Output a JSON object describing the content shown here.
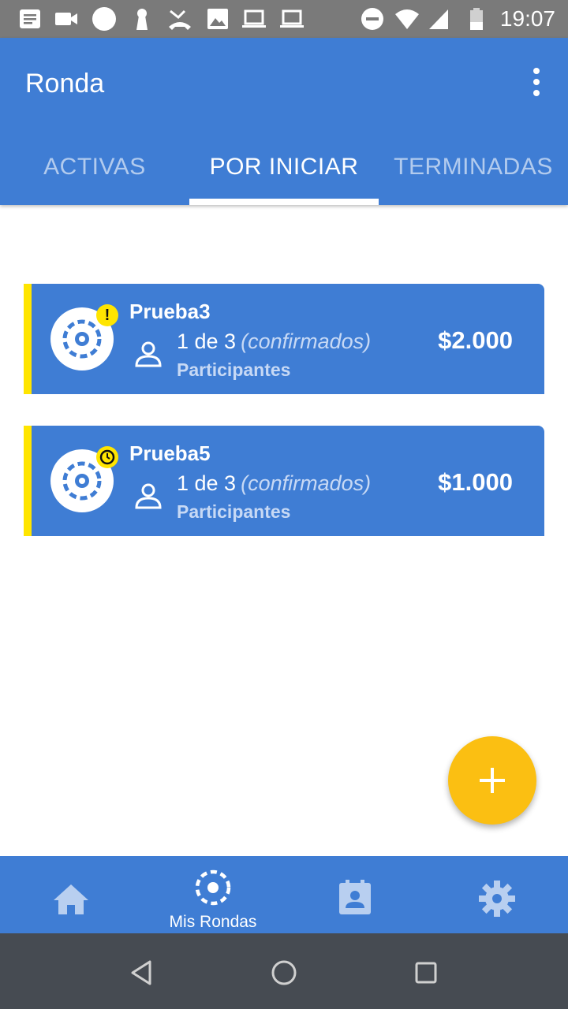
{
  "status_bar": {
    "time": "19:07",
    "left_icons": [
      "notes-icon",
      "video-icon",
      "circle-icon",
      "keyhole-icon",
      "missed-call-icon",
      "image-icon",
      "laptop-icon",
      "laptop-icon"
    ],
    "right_icons": [
      "do-not-disturb-icon",
      "wifi-icon",
      "signal-icon",
      "battery-icon"
    ]
  },
  "app_bar": {
    "title": "Ronda",
    "menu_icon": "more-vert-icon"
  },
  "tabs": [
    {
      "label": "ACTIVAS",
      "selected": false
    },
    {
      "label": "POR INICIAR",
      "selected": true
    },
    {
      "label": "TERMINADAS",
      "selected": false
    }
  ],
  "cards": [
    {
      "name": "Prueba3",
      "status_icon": "alert-icon",
      "status_glyph": "!",
      "participants_count": "1 de 3",
      "confirmed_note": "(confirmados)",
      "participants_label": "Participantes",
      "amount": "$2.000"
    },
    {
      "name": "Prueba5",
      "status_icon": "clock-icon",
      "status_glyph": "",
      "participants_count": "1 de 3",
      "confirmed_note": "(confirmados)",
      "participants_label": "Participantes",
      "amount": "$1.000"
    }
  ],
  "fab": {
    "icon": "plus-icon"
  },
  "bottom_nav": [
    {
      "icon": "home-icon",
      "label": ""
    },
    {
      "icon": "ronda-icon",
      "label": "Mis Rondas",
      "selected": true
    },
    {
      "icon": "contact-calendar-icon",
      "label": ""
    },
    {
      "icon": "settings-icon",
      "label": ""
    }
  ],
  "system_nav": [
    "back-icon",
    "home-circle-icon",
    "recents-icon"
  ],
  "colors": {
    "primary": "#3f7dd4",
    "accent": "#fbbf12",
    "card_stripe": "#ffe500",
    "status_bar": "#7a7a7a",
    "system_nav": "#464b52"
  }
}
